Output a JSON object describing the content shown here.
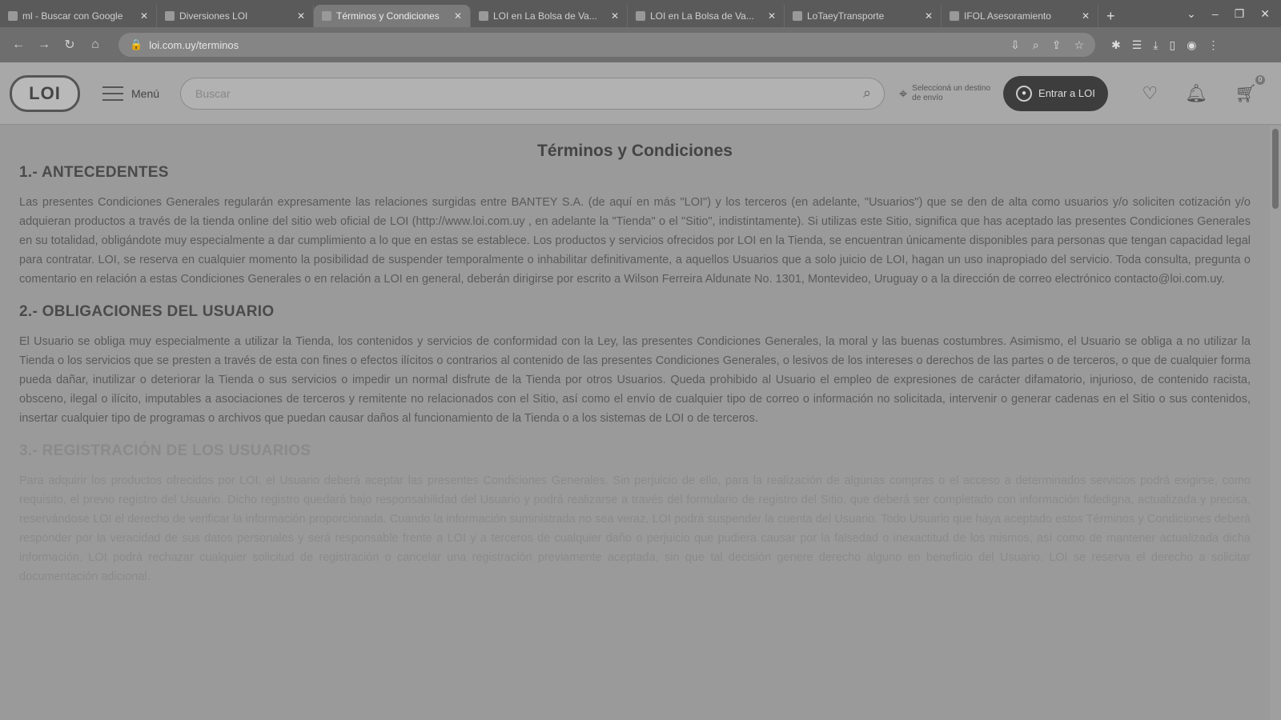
{
  "browser": {
    "tabs": [
      {
        "title": "ml - Buscar con Google"
      },
      {
        "title": "Diversiones LOI"
      },
      {
        "title": "Términos y Condiciones",
        "active": true
      },
      {
        "title": "LOI en La Bolsa de Va..."
      },
      {
        "title": "LOI en La Bolsa de Va..."
      },
      {
        "title": "LoTaeyTransporte"
      },
      {
        "title": "IFOL Asesoramiento"
      }
    ],
    "url": "loi.com.uy/terminos",
    "new_tab": "+",
    "window_controls": [
      "⌄",
      "–",
      "❐",
      "✕"
    ]
  },
  "header": {
    "logo": "LOI",
    "menu_label": "Menú",
    "search_placeholder": "Buscar",
    "location_text": "Seleccioná un destino de envío",
    "login_label": "Entrar a LOI",
    "cart_count": "0"
  },
  "page": {
    "title": "Términos y Condiciones",
    "sections": [
      {
        "heading": "1.- ANTECEDENTES",
        "body": "Las presentes Condiciones Generales regularán expresamente las relaciones surgidas entre BANTEY S.A. (de aquí en más \"LOI\") y los terceros (en adelante, \"Usuarios\") que se den de alta como usuarios y/o soliciten cotización y/o adquieran productos a través de la tienda online del sitio web oficial de LOI (http://www.loi.com.uy , en adelante la \"Tienda\" o el \"Sitio\", indistintamente). Si utilizas este Sitio, significa que has aceptado las presentes Condiciones Generales en su totalidad, obligándote muy especialmente a dar cumplimiento a lo que en estas se establece. Los productos y servicios ofrecidos por LOI en la Tienda, se encuentran únicamente disponibles para personas que tengan capacidad legal para contratar. LOI, se reserva en cualquier momento la posibilidad de suspender temporalmente o inhabilitar definitivamente, a aquellos Usuarios que a solo juicio de LOI, hagan un uso inapropiado del servicio. Toda consulta, pregunta o comentario en relación a estas Condiciones Generales o en relación a LOI en general, deberán dirigirse por escrito a Wilson Ferreira Aldunate No. 1301, Montevideo, Uruguay o a la dirección de correo electrónico contacto@loi.com.uy."
      },
      {
        "heading": "2.- OBLIGACIONES DEL USUARIO",
        "body": "El Usuario se obliga muy especialmente a utilizar la Tienda, los contenidos y servicios de conformidad con la Ley, las presentes Condiciones Generales, la moral y las buenas costumbres. Asimismo, el Usuario se obliga a no utilizar la Tienda o los servicios que se presten a través de esta con fines o efectos ilícitos o contrarios al contenido de las presentes Condiciones Generales, o lesivos de los intereses o derechos de las partes o de terceros, o que de cualquier forma pueda dañar, inutilizar o deteriorar la Tienda o sus servicios o impedir un normal disfrute de la Tienda por otros Usuarios. Queda prohibido al Usuario el empleo de expresiones de carácter difamatorio, injurioso, de contenido racista, obsceno, ilegal o ilícito, imputables a asociaciones de terceros y remitente no relacionados con el Sitio, así como el envío de cualquier tipo de correo o información no solicitada, intervenir o generar cadenas en el Sitio o sus contenidos, insertar cualquier tipo de programas o archivos que puedan causar daños al funcionamiento de la Tienda o a los sistemas de LOI o de terceros."
      },
      {
        "heading": "3.- REGISTRACIÓN DE LOS USUARIOS",
        "body": "Para adquirir los productos ofrecidos por LOI, el Usuario deberá aceptar las presentes Condiciones Generales. Sin perjuicio de ello, para la realización de algunas compras o el acceso a determinados servicios podrá exigirse, como requisito, el previo registro del Usuario. Dicho registro quedará bajo responsabilidad del Usuario y podrá realizarse a través del formulario de registro del Sitio, que deberá ser completado con información fidedigna, actualizada y precisa, reservándose LOI el derecho de verificar la información proporcionada. Cuando la información suministrada no sea veraz, LOI podrá suspender la cuenta del Usuario. Todo Usuario que haya aceptado estos Términos y Condiciones deberá responder por la veracidad de sus datos personales y será responsable frente a LOI y a terceros de cualquier daño o perjuicio que pudiera causar por la falsedad o inexactitud de los mismos, así como de mantener actualizada dicha información. LOI podrá rechazar cualquier solicitud de registración o cancelar una registración previamente aceptada, sin que tal decisión genere derecho alguno en beneficio del Usuario. LOI se reserva el derecho a solicitar documentación adicional."
      }
    ]
  }
}
